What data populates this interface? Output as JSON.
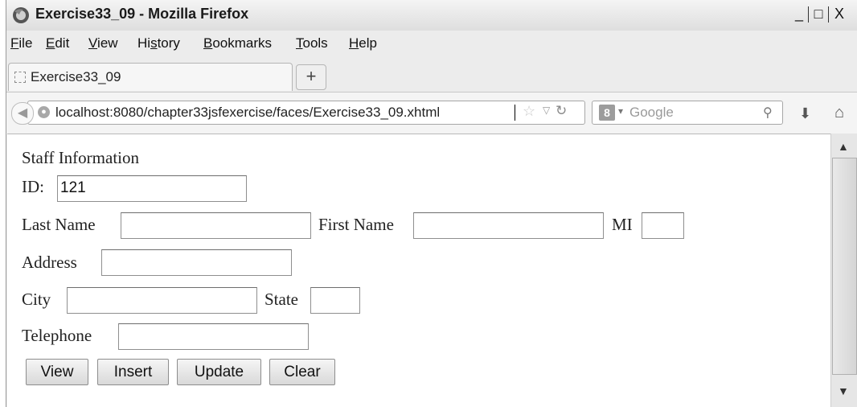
{
  "window": {
    "title": "Exercise33_09 - Mozilla Firefox",
    "controls": {
      "minimize": "_",
      "maximize": "□",
      "close": "X"
    }
  },
  "menu": [
    "File",
    "Edit",
    "View",
    "History",
    "Bookmarks",
    "Tools",
    "Help"
  ],
  "menu_underline": [
    "F",
    "E",
    "V",
    "s",
    "B",
    "T",
    "H"
  ],
  "tab": {
    "title": "Exercise33_09",
    "new_tab": "+"
  },
  "navbar": {
    "url": "localhost:8080/chapter33jsfexercise/faces/Exercise33_09.xhtml",
    "search_engine": "8",
    "search_placeholder": "Google"
  },
  "form": {
    "heading": "Staff Information",
    "id_label": "ID:",
    "id_value": "121",
    "last_name_label": "Last Name",
    "last_name_value": "",
    "first_name_label": "First Name",
    "first_name_value": "",
    "mi_label": "MI",
    "mi_value": "",
    "address_label": "Address",
    "address_value": "",
    "city_label": "City",
    "city_value": "",
    "state_label": "State",
    "state_value": "",
    "telephone_label": "Telephone",
    "telephone_value": ""
  },
  "buttons": {
    "view": "View",
    "insert": "Insert",
    "update": "Update",
    "clear": "Clear"
  },
  "icons": {
    "app": "firefox-icon",
    "back": "back-arrow-icon",
    "site": "globe-icon",
    "bookmark": "star-icon",
    "history_dropdown": "chevron-down-icon",
    "reload": "reload-icon",
    "search": "magnifier-icon",
    "download": "download-icon",
    "home": "home-icon"
  }
}
